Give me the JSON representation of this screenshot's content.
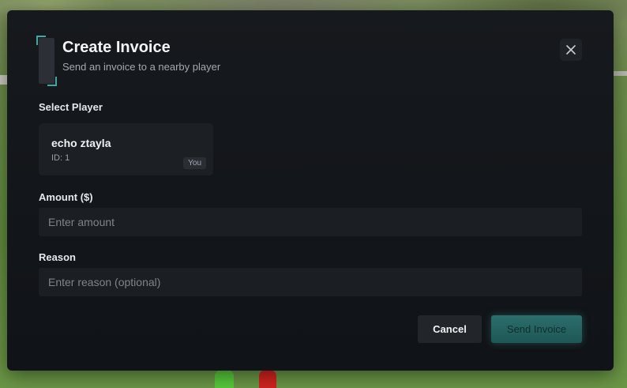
{
  "modal": {
    "title": "Create Invoice",
    "subtitle": "Send an invoice to a nearby player",
    "close_icon": "close-icon"
  },
  "select_player": {
    "label": "Select Player",
    "players": [
      {
        "name": "echo ztayla",
        "id_text": "ID: 1",
        "badge": "You"
      }
    ]
  },
  "amount": {
    "label": "Amount ($)",
    "placeholder": "Enter amount",
    "value": ""
  },
  "reason": {
    "label": "Reason",
    "placeholder": "Enter reason (optional)",
    "value": ""
  },
  "actions": {
    "cancel_label": "Cancel",
    "send_label": "Send Invoice"
  },
  "colors": {
    "accent": "#3fa8a2",
    "modal_bg": "#13161a",
    "send_button": "#266563"
  }
}
